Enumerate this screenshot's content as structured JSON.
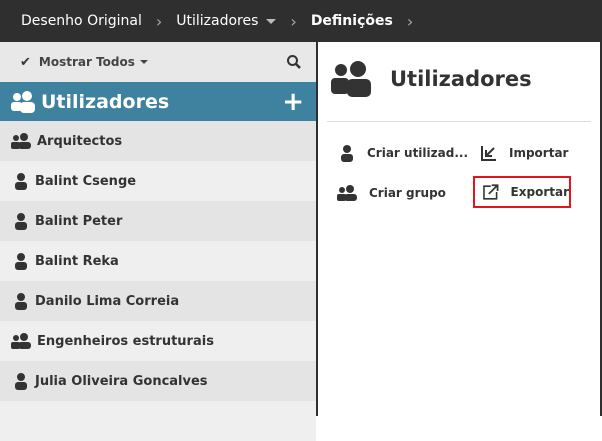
{
  "breadcrumb": [
    {
      "label": "Desenho Original"
    },
    {
      "label": "Utilizadores"
    },
    {
      "label": "Definições"
    }
  ],
  "left": {
    "filter_label": "Mostrar Todos",
    "header_title": "Utilizadores",
    "items": [
      {
        "label": "Arquitectos",
        "type": "group"
      },
      {
        "label": "Balint Csenge",
        "type": "user"
      },
      {
        "label": "Balint Peter",
        "type": "user"
      },
      {
        "label": "Balint Reka",
        "type": "user"
      },
      {
        "label": "Danilo Lima Correia",
        "type": "user"
      },
      {
        "label": "Engenheiros estruturais",
        "type": "group"
      },
      {
        "label": "Julia Oliveira Goncalves",
        "type": "user"
      }
    ]
  },
  "right": {
    "title": "Utilizadores",
    "actions": {
      "create_user": "Criar utilizad...",
      "import": "Importar",
      "create_group": "Criar grupo",
      "export": "Exportar"
    }
  },
  "colors": {
    "header": "#3f82a0",
    "topbar": "#2f2f2f",
    "highlight": "#e0161c"
  }
}
